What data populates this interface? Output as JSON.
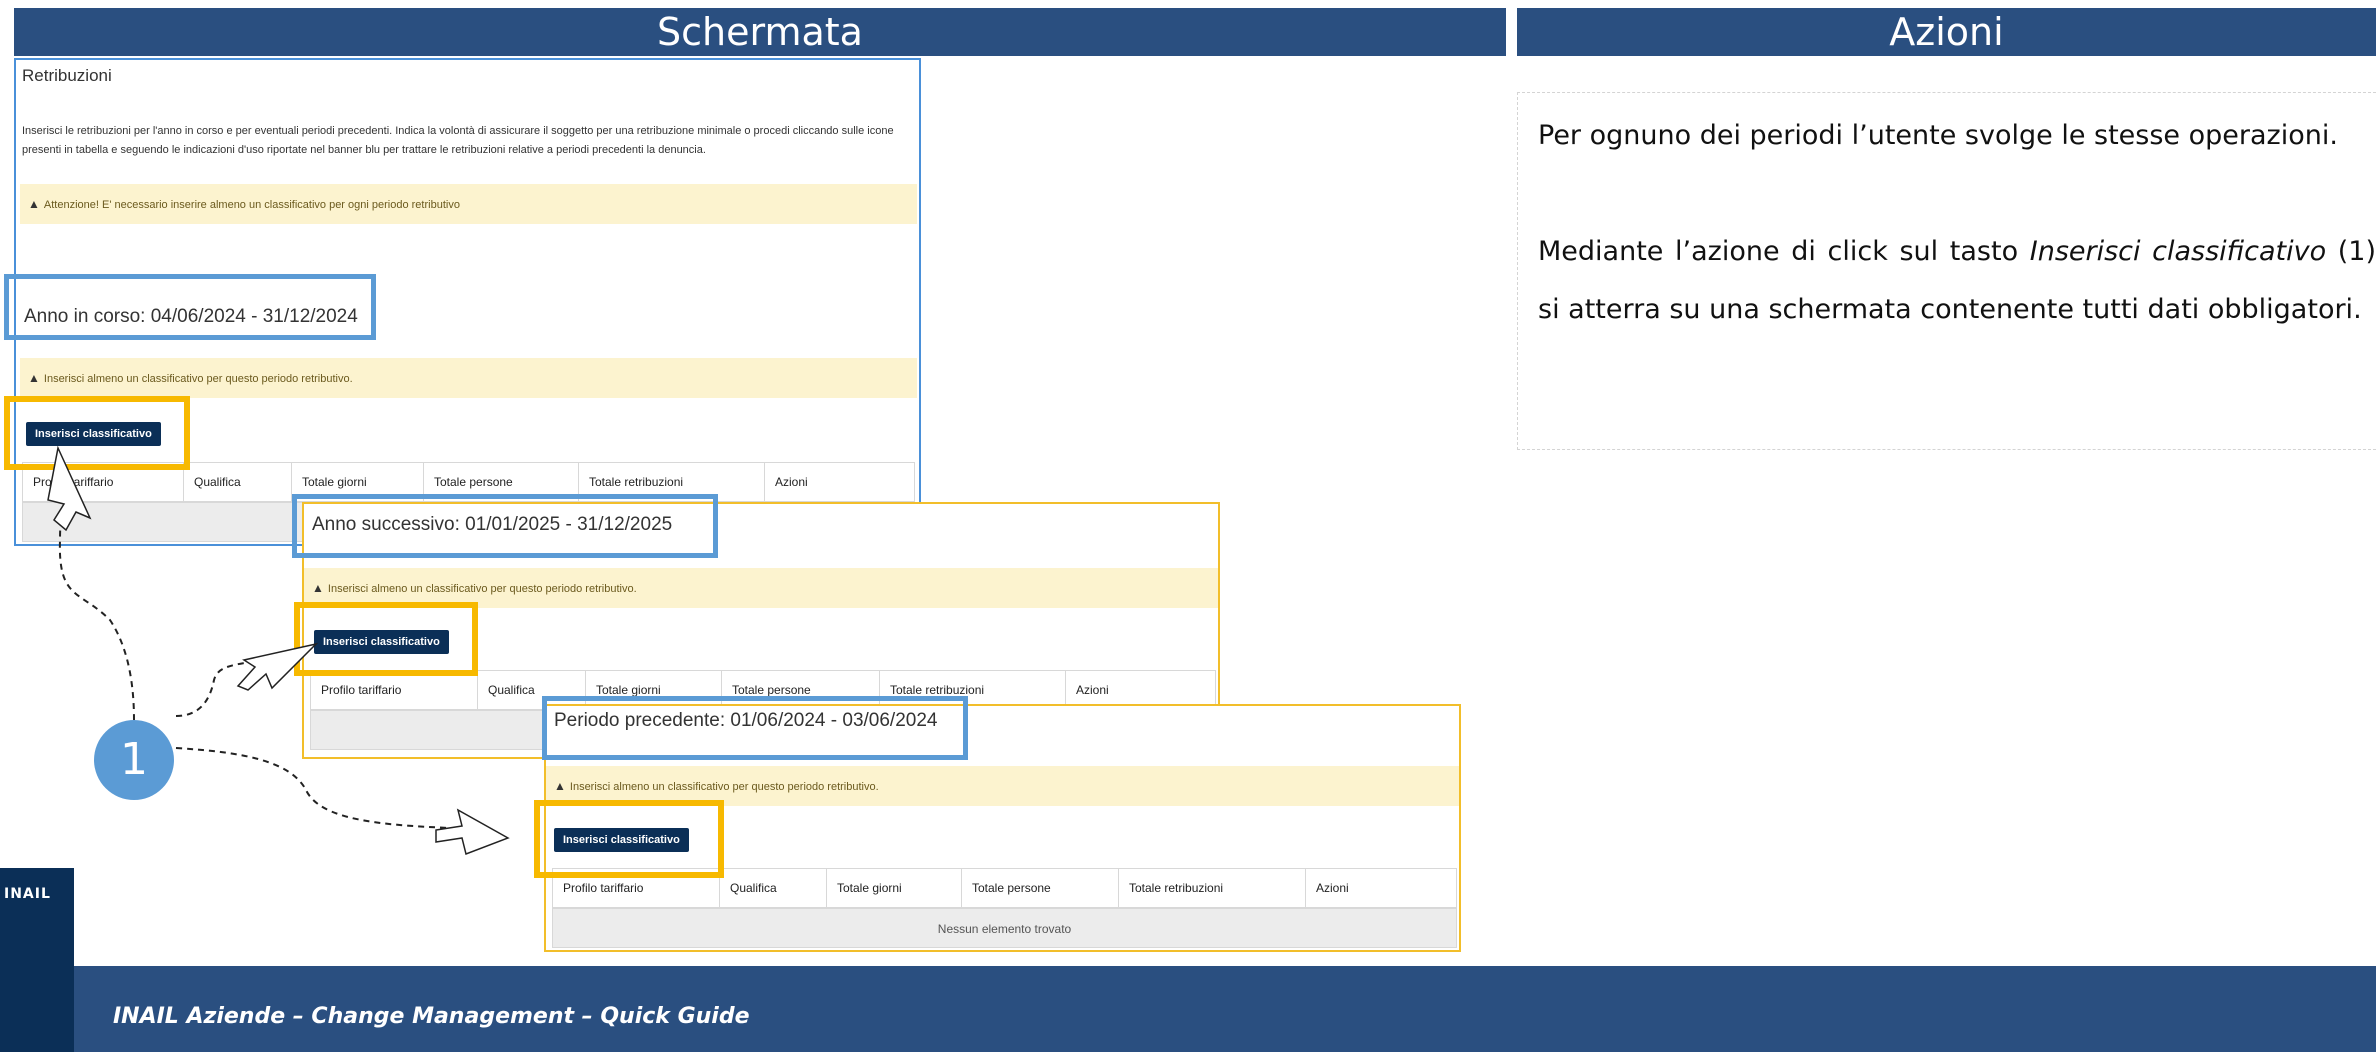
{
  "headers": {
    "left": "Schermata",
    "right": "Azioni"
  },
  "screen1": {
    "title": "Retribuzioni",
    "description": "Inserisci le retribuzioni per l'anno in corso e per eventuali periodi precedenti. Indica la volontà di assicurare il soggetto per una retribuzione minimale o procedi cliccando sulle icone presenti in tabella e seguendo le indicazioni d'uso riportate nel banner blu per trattare le retribuzioni relative a periodi precedenti la denuncia.",
    "attention": "Attenzione! E' necessario inserire almeno un classificativo per ogni periodo retributivo",
    "period": "Anno in corso: 04/06/2024 - 31/12/2024",
    "warning": "Inserisci almeno un classificativo per questo periodo retributivo.",
    "button": "Inserisci classificativo",
    "columns": [
      "Profilo tariffario",
      "Qualifica",
      "Totale giorni",
      "Totale persone",
      "Totale retribuzioni",
      "Azioni"
    ]
  },
  "screen2": {
    "period": "Anno successivo: 01/01/2025 - 31/12/2025",
    "warning": "Inserisci almeno un classificativo per questo periodo retributivo.",
    "button": "Inserisci classificativo",
    "columns": [
      "Profilo tariffario",
      "Qualifica",
      "Totale giorni",
      "Totale persone",
      "Totale retribuzioni",
      "Azioni"
    ]
  },
  "screen3": {
    "period": "Periodo precedente: 01/06/2024 - 03/06/2024",
    "warning": "Inserisci almeno un classificativo per questo periodo retributivo.",
    "button": "Inserisci classificativo",
    "columns": [
      "Profilo tariffario",
      "Qualifica",
      "Totale giorni",
      "Totale persone",
      "Totale retribuzioni",
      "Azioni"
    ],
    "empty": "Nessun elemento trovato"
  },
  "actions": {
    "para1": "Per ognuno dei periodi l’utente svolge le stesse operazioni.",
    "para2_pre": "Mediante l’azione di click sul tasto ",
    "para2_em": "Inserisci classificativo",
    "para2_post": " (1) si atterra su una schermata contenente tutti dati obbligatori."
  },
  "marker": "1",
  "footer": "INAIL Aziende – Change Management – Quick Guide",
  "logo": "INAIL",
  "colors": {
    "header": "#2a4f80",
    "highlight_blue": "#5b9bd5",
    "highlight_yellow": "#f7b900",
    "button": "#0b2f57",
    "warning_bg": "#fcf3cf"
  }
}
